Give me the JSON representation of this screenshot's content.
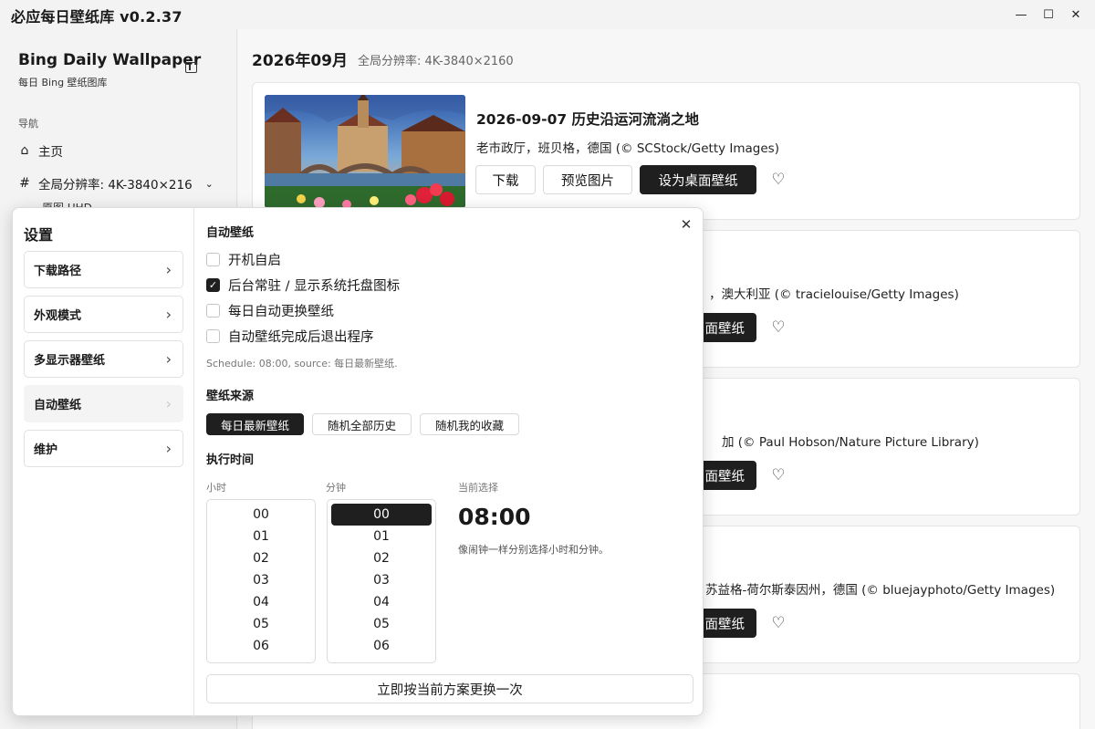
{
  "window": {
    "title": "必应每日壁纸库 v0.2.37",
    "min_glyph": "—",
    "max_glyph": "☐",
    "close_glyph": "✕"
  },
  "sidebar": {
    "brand_title": "Bing Daily Wallpaper",
    "brand_subtitle": "每日 Bing 壁纸图库",
    "nav_heading": "导航",
    "home_label": "主页",
    "resolution_label": "全局分辨率: 4K-3840×216",
    "sub_label": "原图 UHD"
  },
  "main": {
    "month_title": "2026年09月",
    "global_resolution": "全局分辨率: 4K-3840×2160",
    "cards": [
      {
        "title": "2026-09-07 历史沿运河流淌之地",
        "desc": "老市政厅，班贝格，德国 (© SCStock/Getty Images)",
        "download": "下载",
        "preview": "预览图片",
        "set_wallpaper": "设为桌面壁纸"
      },
      {
        "title": "",
        "desc": "，澳大利亚 (© tracielouise/Getty Images)",
        "set_wallpaper": "面壁纸"
      },
      {
        "title": "",
        "desc": "加 (© Paul Hobson/Nature Picture Library)",
        "set_wallpaper": "面壁纸"
      },
      {
        "title": "",
        "desc": "苏益格-荷尔斯泰因州，德国 (© bluejayphoto/Getty Images)",
        "set_wallpaper": "面壁纸"
      }
    ]
  },
  "settings": {
    "title": "设置",
    "menu": [
      {
        "label": "下载路径"
      },
      {
        "label": "外观模式"
      },
      {
        "label": "多显示器壁纸"
      },
      {
        "label": "自动壁纸"
      },
      {
        "label": "维护"
      }
    ],
    "active_index": 3,
    "auto": {
      "section_title": "自动壁纸",
      "options": [
        {
          "label": "开机自启",
          "checked": false
        },
        {
          "label": "后台常驻 / 显示系统托盘图标",
          "checked": true
        },
        {
          "label": "每日自动更换壁纸",
          "checked": false
        },
        {
          "label": "自动壁纸完成后退出程序",
          "checked": false
        }
      ],
      "schedule_hint": "Schedule: 08:00, source: 每日最新壁纸."
    },
    "source": {
      "title": "壁纸来源",
      "options": [
        "每日最新壁纸",
        "随机全部历史",
        "随机我的收藏"
      ],
      "selected": "每日最新壁纸"
    },
    "time": {
      "title": "执行时间",
      "hour_label": "小时",
      "minute_label": "分钟",
      "current_label": "当前选择",
      "hours": [
        "00",
        "01",
        "02",
        "03",
        "04",
        "05",
        "06"
      ],
      "minutes": [
        "00",
        "01",
        "02",
        "03",
        "04",
        "05",
        "06"
      ],
      "selected_minute": "00",
      "current_value": "08:00",
      "current_hint": "像闹钟一样分别选择小时和分钟。"
    },
    "apply_button": "立即按当前方案更换一次"
  },
  "colors": {
    "accent_dark": "#1f1f1f"
  }
}
